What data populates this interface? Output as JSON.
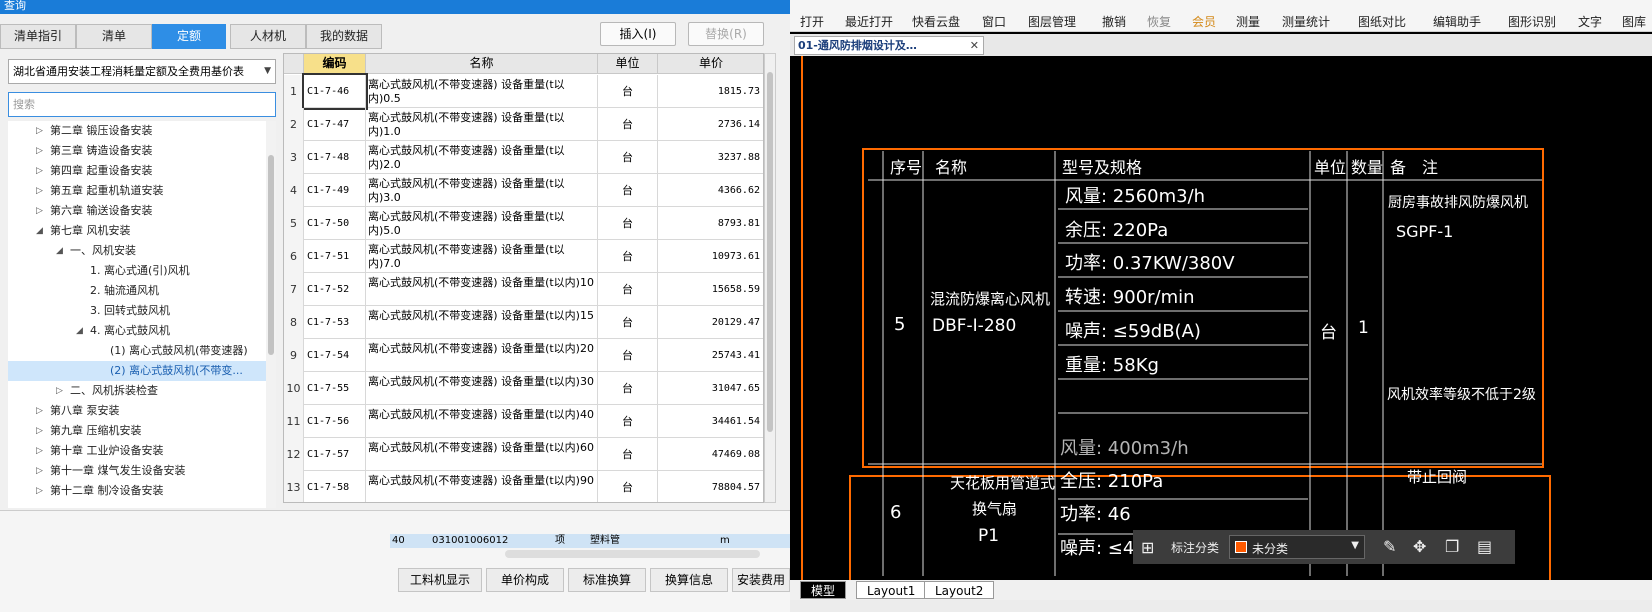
{
  "window": {
    "title": "查询"
  },
  "tabs": [
    {
      "label": "清单指引"
    },
    {
      "label": "清单"
    },
    {
      "label": "定额"
    },
    {
      "label": "人材机"
    },
    {
      "label": "我的数据"
    }
  ],
  "buttons": {
    "insert": "插入(I)",
    "replace": "替换(R)"
  },
  "library": {
    "selected": "湖北省通用安装工程消耗量定额及全费用基价表"
  },
  "search": {
    "placeholder": "搜索"
  },
  "tree": [
    {
      "label": "第二章 锻压设备安装"
    },
    {
      "label": "第三章 铸造设备安装"
    },
    {
      "label": "第四章 起重设备安装"
    },
    {
      "label": "第五章 起重机轨道安装"
    },
    {
      "label": "第六章 输送设备安装"
    },
    {
      "label": "第七章 风机安装"
    },
    {
      "label": "一、风机安装"
    },
    {
      "label": "1. 离心式通(引)风机"
    },
    {
      "label": "2. 轴流通风机"
    },
    {
      "label": "3. 回转式鼓风机"
    },
    {
      "label": "4. 离心式鼓风机"
    },
    {
      "label": "(1) 离心式鼓风机(带变速器)"
    },
    {
      "label": "(2) 离心式鼓风机(不带变..."
    },
    {
      "label": "二、风机拆装检查"
    },
    {
      "label": "第八章 泵安装"
    },
    {
      "label": "第九章 压缩机安装"
    },
    {
      "label": "第十章 工业炉设备安装"
    },
    {
      "label": "第十一章 煤气发生设备安装"
    },
    {
      "label": "第十二章 制冷设备安装"
    }
  ],
  "grid": {
    "headers": [
      "编码",
      "名称",
      "单位",
      "单价"
    ],
    "rows": [
      {
        "n": "1",
        "code": "C1-7-46",
        "name": "离心式鼓风机(不带变速器) 设备重量(t以内)0.5",
        "unit": "台",
        "price": "1815.73"
      },
      {
        "n": "2",
        "code": "C1-7-47",
        "name": "离心式鼓风机(不带变速器) 设备重量(t以内)1.0",
        "unit": "台",
        "price": "2736.14"
      },
      {
        "n": "3",
        "code": "C1-7-48",
        "name": "离心式鼓风机(不带变速器) 设备重量(t以内)2.0",
        "unit": "台",
        "price": "3237.88"
      },
      {
        "n": "4",
        "code": "C1-7-49",
        "name": "离心式鼓风机(不带变速器) 设备重量(t以内)3.0",
        "unit": "台",
        "price": "4366.62"
      },
      {
        "n": "5",
        "code": "C1-7-50",
        "name": "离心式鼓风机(不带变速器) 设备重量(t以内)5.0",
        "unit": "台",
        "price": "8793.81"
      },
      {
        "n": "6",
        "code": "C1-7-51",
        "name": "离心式鼓风机(不带变速器) 设备重量(t以内)7.0",
        "unit": "台",
        "price": "10973.61"
      },
      {
        "n": "7",
        "code": "C1-7-52",
        "name": "离心式鼓风机(不带变速器) 设备重量(t以内)10",
        "unit": "台",
        "price": "15658.59"
      },
      {
        "n": "8",
        "code": "C1-7-53",
        "name": "离心式鼓风机(不带变速器) 设备重量(t以内)15",
        "unit": "台",
        "price": "20129.47"
      },
      {
        "n": "9",
        "code": "C1-7-54",
        "name": "离心式鼓风机(不带变速器) 设备重量(t以内)20",
        "unit": "台",
        "price": "25743.41"
      },
      {
        "n": "10",
        "code": "C1-7-55",
        "name": "离心式鼓风机(不带变速器) 设备重量(t以内)30",
        "unit": "台",
        "price": "31047.65"
      },
      {
        "n": "11",
        "code": "C1-7-56",
        "name": "离心式鼓风机(不带变速器) 设备重量(t以内)40",
        "unit": "台",
        "price": "34461.54"
      },
      {
        "n": "12",
        "code": "C1-7-57",
        "name": "离心式鼓风机(不带变速器) 设备重量(t以内)60",
        "unit": "台",
        "price": "47469.08"
      },
      {
        "n": "13",
        "code": "C1-7-58",
        "name": "离心式鼓风机(不带变速器) 设备重量(t以内)90",
        "unit": "台",
        "price": "78804.57"
      }
    ]
  },
  "lower": {
    "row_num": "40",
    "row_code": "031001006012",
    "row_unit": "项",
    "row_name": "塑料管",
    "row_m": "m"
  },
  "bottom_tabs": [
    "工料机显示",
    "单价构成",
    "标准换算",
    "换算信息",
    "安装费用"
  ],
  "toolbar": [
    {
      "label": "打开",
      "icon": "folder-icon"
    },
    {
      "label": "最近打开",
      "icon": "clock-icon"
    },
    {
      "label": "快看云盘",
      "icon": "cloud-icon"
    },
    {
      "label": "窗口",
      "icon": "window-icon"
    },
    {
      "label": "图层管理",
      "icon": "layers-icon"
    },
    {
      "label": "撤销",
      "icon": "undo-icon"
    },
    {
      "label": "恢复",
      "icon": "redo-icon"
    },
    {
      "label": "会员",
      "icon": "vip-icon"
    },
    {
      "label": "测量",
      "icon": "ruler-icon"
    },
    {
      "label": "测量统计",
      "icon": "stats-icon"
    },
    {
      "label": "图纸对比",
      "icon": "compare-icon"
    },
    {
      "label": "编辑助手",
      "icon": "edit-icon"
    },
    {
      "label": "图形识别",
      "icon": "recognize-icon"
    },
    {
      "label": "文字",
      "icon": "text-icon"
    },
    {
      "label": "图库",
      "icon": "library-icon"
    }
  ],
  "drawing": {
    "tab": "01-通风防排烟设计及…",
    "headers": {
      "seq": "序号",
      "name": "名称",
      "spec": "型号及规格",
      "unit": "单位",
      "qty": "数量",
      "remark": "备　注"
    },
    "r5": {
      "seq": "5",
      "name1": "混流防爆离心风机",
      "name2": "DBF-I-280",
      "specs": [
        "风量: 2560m3/h",
        "余压: 220Pa",
        "功率: 0.37KW/380V",
        "转速: 900r/min",
        "噪声: ≤59dB(A)",
        "重量: 58Kg"
      ],
      "unit": "台",
      "qty": "1",
      "remark1": "厨房事故排风防爆风机",
      "remark2": "SGPF-1",
      "remark3": "风机效率等级不低于2级"
    },
    "r6": {
      "seq": "6",
      "name1": "天花板用管道式",
      "name2": "换气扇",
      "name3": "P1",
      "specs": [
        "风量: 400m3/h",
        "全压: 210Pa",
        "功率: 46",
        "噪声: ≤43dB(A)"
      ],
      "remark1": "带止回阀"
    }
  },
  "annotation": {
    "label": "标注分类",
    "value": "未分类"
  },
  "layouts": [
    "模型",
    "Layout1",
    "Layout2"
  ]
}
